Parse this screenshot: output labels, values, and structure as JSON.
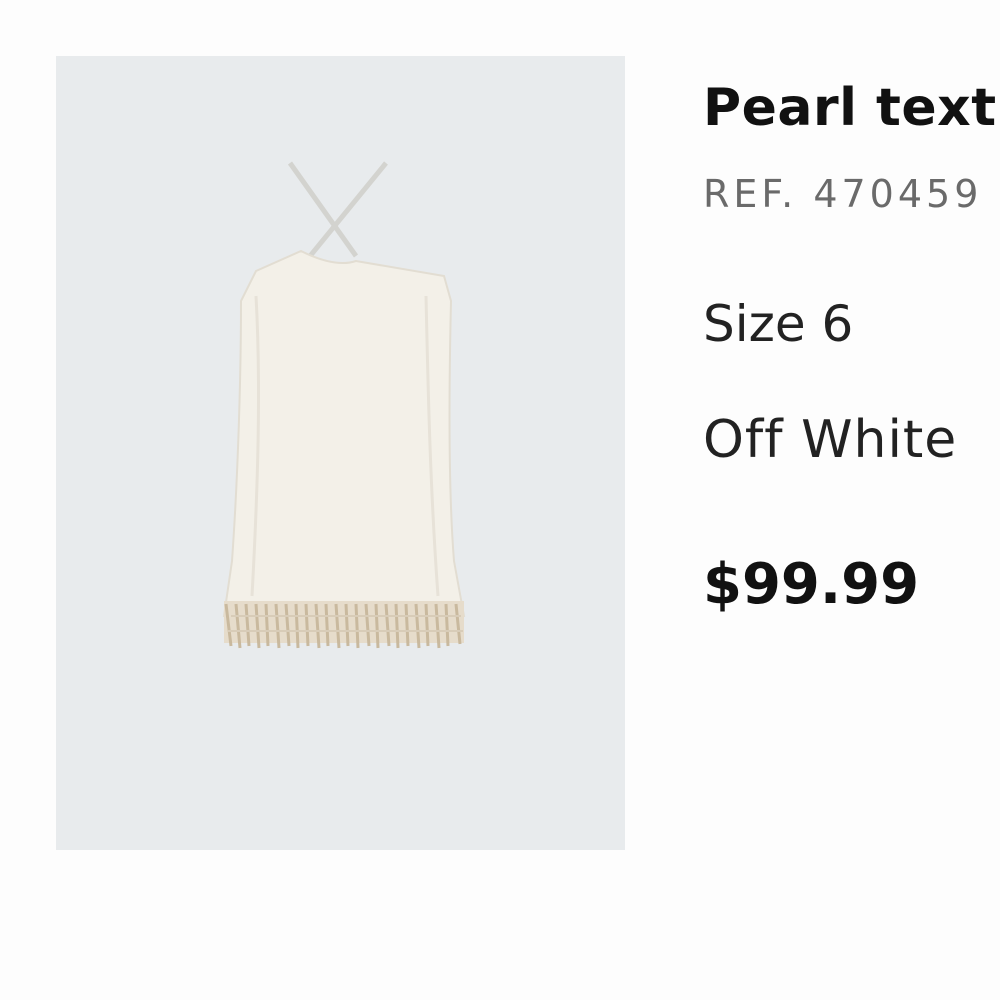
{
  "product": {
    "image_icon": "dress-photo",
    "title": "Pearl text",
    "ref": "REF. 470459",
    "size": "Size 6",
    "color": "Off White",
    "price": "$99.99"
  },
  "colors": {
    "image_background": "#e8ebed",
    "page_background": "#fdfdfd",
    "ref_text": "#6a6a6a"
  }
}
